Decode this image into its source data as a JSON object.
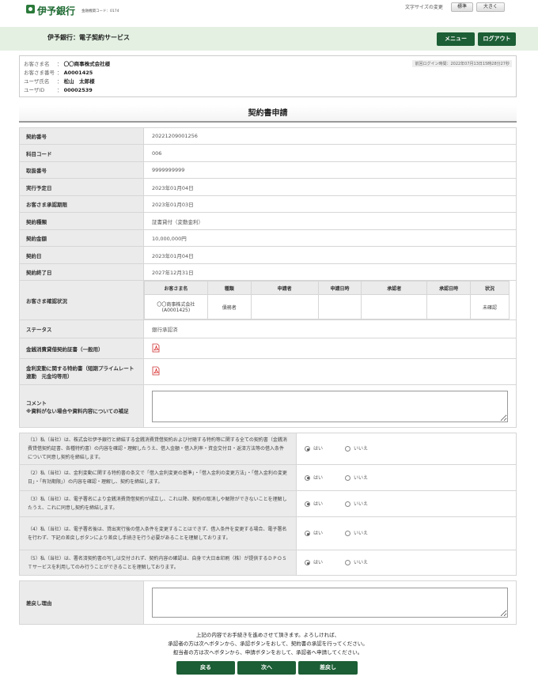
{
  "brand": {
    "name": "伊予銀行",
    "bank_code": "金融機関コード：0174"
  },
  "font_size": {
    "label": "文字サイズの変更",
    "standard": "標準",
    "large": "大きく"
  },
  "header": {
    "service_title": "伊予銀行：電子契約サービス",
    "menu_button": "メニュー",
    "logout_button": "ログアウト"
  },
  "user": {
    "customer_name_label": "お客さま名",
    "customer_name": "〇〇商事株式会社様",
    "customer_no_label": "お客さま番号",
    "customer_no": "A0001425",
    "user_name_label": "ユーザ氏名",
    "user_name": "松山　太郎様",
    "user_id_label": "ユーザID",
    "user_id": "00002539",
    "last_login": "前回ログイン時間：2022年07月13日15時28分27秒"
  },
  "page_title": "契約書申請",
  "fields": {
    "contract_no": {
      "label": "契約番号",
      "value": "20221209001256"
    },
    "subject_code": {
      "label": "科目コード",
      "value": "006"
    },
    "transaction_no": {
      "label": "取扱番号",
      "value": "9999999999"
    },
    "exec_date": {
      "label": "実行予定日",
      "value": "2023年01月04日"
    },
    "approval_deadline": {
      "label": "お客さま承認期限",
      "value": "2023年01月03日"
    },
    "contract_type": {
      "label": "契約種類",
      "value": "証書貸付（変動金利）"
    },
    "amount": {
      "label": "契約金額",
      "value": "10,000,000円"
    },
    "contract_date": {
      "label": "契約日",
      "value": "2023年01月04日"
    },
    "end_date": {
      "label": "契約終了日",
      "value": "2027年12月31日"
    }
  },
  "confirm_status": {
    "label": "お客さま確認状況",
    "headers": [
      "お客さま名",
      "種類",
      "申請者",
      "申請日時",
      "承認者",
      "承認日時",
      "状況"
    ],
    "row": {
      "customer": "〇〇商事株式会社",
      "customer_no": "(A0001425)",
      "type": "債務者",
      "applicant": "",
      "applied_at": "",
      "approver": "",
      "approved_at": "",
      "status": "未確認"
    }
  },
  "status": {
    "label": "ステータス",
    "value": "銀行承認済"
  },
  "doc1_label": "金銭消費貸借契約証書（一般用）",
  "doc2_label": "金利変動に関する特約書（短期プライムレート連動　元金均等用）",
  "comment_label": "コメント",
  "comment_note": "※資料がない場合や資料内容についての補足",
  "comment_value": "",
  "confirmations": [
    {
      "text": "（1）私（当社）は、株式会社伊予銀行と締結する金銭消費貸借契約および付随する特約等に関する全ての契約書（金銭消費貸借契約証書、各種特約書）の内容を確認・理解したうえ、借入金額・借入利率・資金交付日・返済方法等の借入条件について同意し契約を締結します。",
      "yes": "はい",
      "no": "いいえ"
    },
    {
      "text": "（2）私（当社）は、金利変動に関する特約書の条文で「借入金利変更の基準」・「借入金利の変更方法」・「借入金利の変更日」・「有効期限」）の内容を確認・理解し、契約を締結します。",
      "yes": "はい",
      "no": "いいえ"
    },
    {
      "text": "（3）私（当社）は、電子署名により金銭消費貸借契約が成立し、これ以降、契約の取消しや解除ができないことを理解したうえ、これに同意し契約を締結します。",
      "yes": "はい",
      "no": "いいえ"
    },
    {
      "text": "（4）私（当社）は、電子署名後は、貸出実行後の借入条件を変更することはできず、借入条件を変更する場合、電子署名を行わず、下記の差戻しボタンにより差戻し手続きを行う必要があることを理解しております。",
      "yes": "はい",
      "no": "いいえ"
    },
    {
      "text": "（5）私（当社）は、署名済契約書の写しは交付されず、契約内容の確認は、自身で大日本印刷（株）が提供するＤＰＯＳＴサービスを利用してのみ行うことができることを理解しております。",
      "yes": "はい",
      "no": "いいえ"
    }
  ],
  "return_reason_label": "差戻し理由",
  "return_reason_value": "",
  "instructions": [
    "上記の内容でお手続きを進めさせて頂きます。よろしければ、",
    "承認者の方は次へボタンから、承認ボタンをおして、契約書の承認を行ってください。",
    "担当者の方は次へボタンから、申請ボタンをおして、承認者へ申請してください。"
  ],
  "buttons": {
    "back": "戻る",
    "next": "次へ",
    "return": "差戻し"
  }
}
